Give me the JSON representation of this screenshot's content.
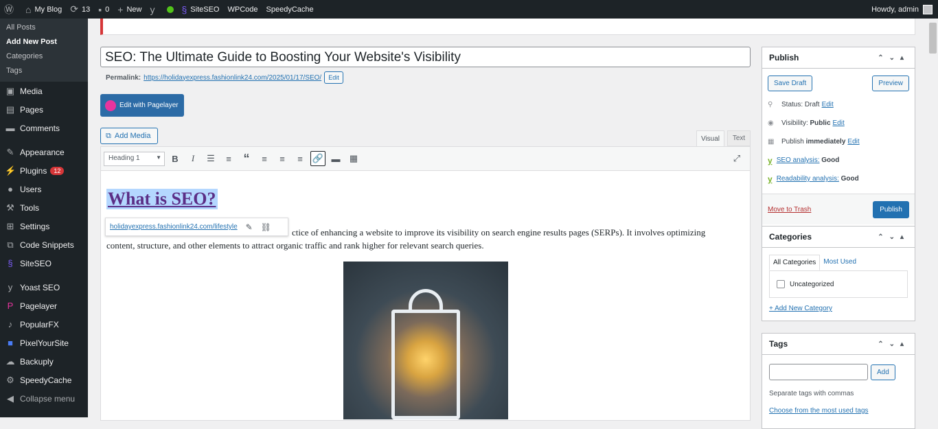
{
  "adminbar": {
    "site": "My Blog",
    "updates": "13",
    "comments": "0",
    "new": "New",
    "siteseo": "SiteSEO",
    "wpcode": "WPCode",
    "speedycache": "SpeedyCache",
    "howdy": "Howdy, admin"
  },
  "sidebar": {
    "sub": [
      "All Posts",
      "Add New Post",
      "Categories",
      "Tags"
    ],
    "menu": {
      "media": "Media",
      "pages": "Pages",
      "comments": "Comments",
      "appearance": "Appearance",
      "plugins": "Plugins",
      "plugins_badge": "12",
      "users": "Users",
      "tools": "Tools",
      "settings": "Settings",
      "snippets": "Code Snippets",
      "siteseo": "SiteSEO",
      "yoast": "Yoast SEO",
      "pagelayer": "Pagelayer",
      "popularfx": "PopularFX",
      "pixel": "PixelYourSite",
      "backuply": "Backuply",
      "speedycache": "SpeedyCache",
      "collapse": "Collapse menu"
    }
  },
  "editor": {
    "title": "SEO: The Ultimate Guide to Boosting Your Website's Visibility",
    "permalink_label": "Permalink:",
    "permalink_url": "https://holidayexpress.fashionlink24.com/2025/01/17/SEO/",
    "edit": "Edit",
    "pagelayer": "Edit with Pagelayer",
    "add_media": "Add Media",
    "tab_visual": "Visual",
    "tab_text": "Text",
    "format": "Heading 1",
    "heading": "What is SEO?",
    "link_url": "holidayexpress.fashionlink24.com/lifestyle",
    "para_line1": "ctice of enhancing a website to improve its visibility on search engine results pages (SERPs). It involves optimizing",
    "para_line2": "content, structure, and other elements to attract organic traffic and rank higher for relevant search queries."
  },
  "publish": {
    "title": "Publish",
    "save_draft": "Save Draft",
    "preview": "Preview",
    "status": "Status: Draft",
    "visibility_label": "Visibility:",
    "visibility_value": "Public",
    "publish_label": "Publish",
    "publish_value": "immediately",
    "edit": "Edit",
    "seo_analysis": "SEO analysis:",
    "seo_value": "Good",
    "read_analysis": "Readability analysis:",
    "read_value": "Good",
    "trash": "Move to Trash",
    "publish_btn": "Publish"
  },
  "categories": {
    "title": "Categories",
    "tab_all": "All Categories",
    "tab_used": "Most Used",
    "item": "Uncategorized",
    "add": "+ Add New Category"
  },
  "tags": {
    "title": "Tags",
    "add": "Add",
    "hint": "Separate tags with commas",
    "choose": "Choose from the most used tags"
  }
}
